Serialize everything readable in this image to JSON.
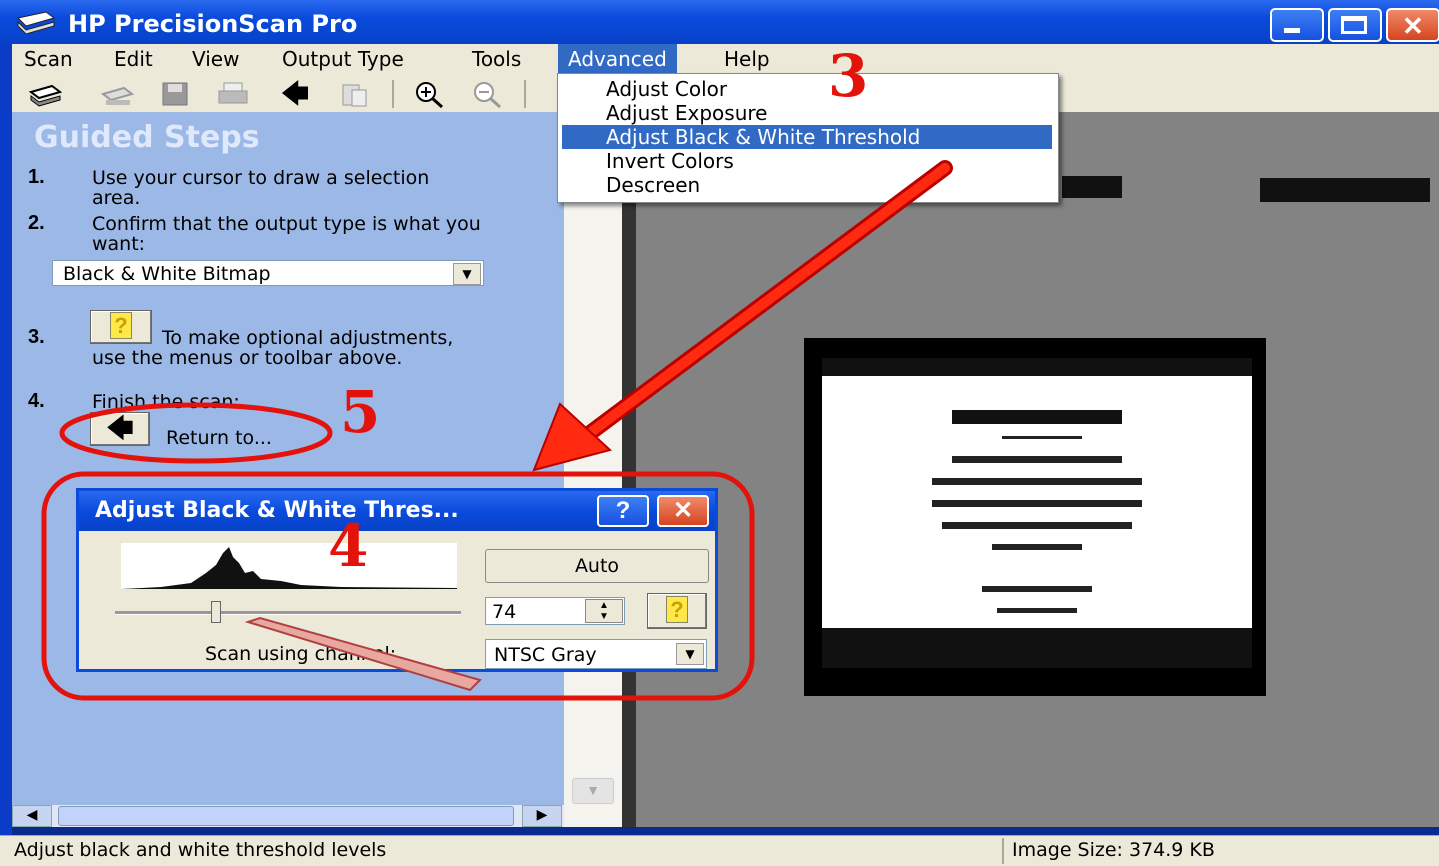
{
  "window": {
    "title": "HP PrecisionScan Pro"
  },
  "menu": {
    "items": [
      "Scan",
      "Edit",
      "View",
      "Output Type",
      "Tools",
      "Advanced",
      "Help"
    ],
    "active": "Advanced"
  },
  "advanced_menu": {
    "items": [
      "Adjust Color",
      "Adjust Exposure",
      "Adjust Black & White Threshold",
      "Invert Colors",
      "Descreen"
    ],
    "highlighted": "Adjust Black & White Threshold"
  },
  "guided_steps": {
    "heading": "Guided Steps",
    "steps": [
      {
        "num": "1.",
        "text": "Use your cursor to draw a selection area."
      },
      {
        "num": "2.",
        "text": "Confirm that the output type is what you want:"
      },
      {
        "num": "3.",
        "text": "To make optional adjustments, use the menus or toolbar above."
      },
      {
        "num": "4.",
        "text": "Finish the scan:"
      }
    ],
    "output_type": "Black & White Bitmap",
    "return_label": "Return to..."
  },
  "dialog": {
    "title": "Adjust Black & White Thres...",
    "auto_label": "Auto",
    "threshold_value": "74",
    "channel_label": "Scan using channel:",
    "channel_value": "NTSC Gray"
  },
  "status": {
    "message": "Adjust black and white threshold levels",
    "image_size": "Image Size: 374.9 KB"
  },
  "annotations": [
    "3",
    "4",
    "5"
  ],
  "colors": {
    "accent": "#316ac5",
    "annotation": "#e3120b",
    "panel": "#9bb8e6"
  }
}
